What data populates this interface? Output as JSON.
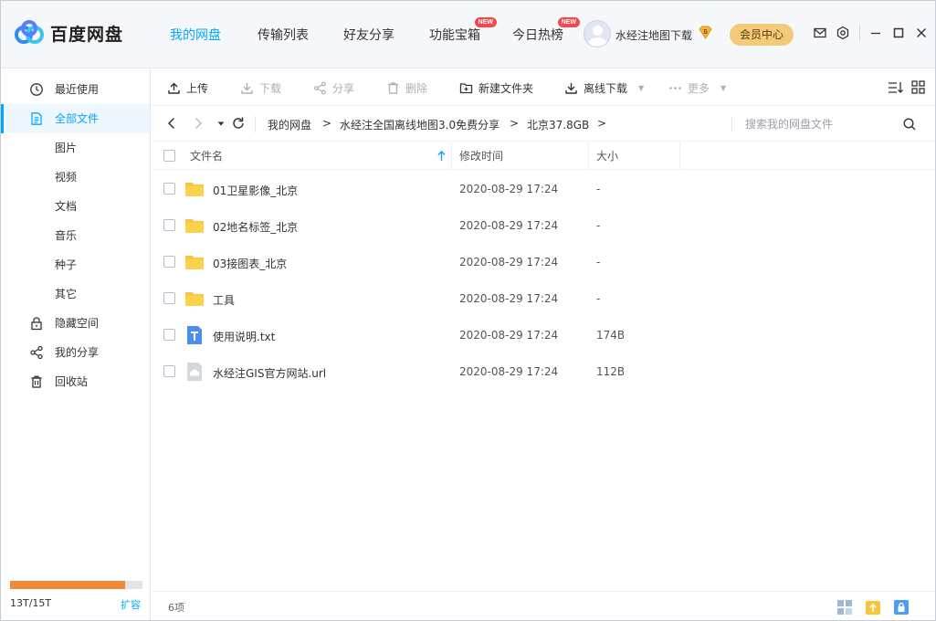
{
  "app": {
    "name": "百度网盘"
  },
  "nav": {
    "tabs": [
      {
        "label": "我的网盘",
        "active": true
      },
      {
        "label": "传输列表"
      },
      {
        "label": "好友分享"
      },
      {
        "label": "功能宝箱",
        "badge": "NEW"
      },
      {
        "label": "今日热榜",
        "badge": "NEW"
      }
    ],
    "username": "水经注地图下载",
    "member_label": "会员中心",
    "accent_color": "#06a7ff"
  },
  "sidebar": {
    "items": [
      {
        "label": "最近使用",
        "icon": "clock-icon"
      },
      {
        "label": "全部文件",
        "icon": "document-icon",
        "active": true
      },
      {
        "label": "图片"
      },
      {
        "label": "视频"
      },
      {
        "label": "文档"
      },
      {
        "label": "音乐"
      },
      {
        "label": "种子"
      },
      {
        "label": "其它"
      },
      {
        "label": "隐藏空间",
        "icon": "lock-icon"
      },
      {
        "label": "我的分享",
        "icon": "share-icon"
      },
      {
        "label": "回收站",
        "icon": "trash-icon"
      }
    ],
    "quota": {
      "text": "13T/15T",
      "used_fraction": 0.867,
      "expand_label": "扩容"
    }
  },
  "toolbar": {
    "upload": "上传",
    "download": "下载",
    "share": "分享",
    "delete": "删除",
    "new_folder": "新建文件夹",
    "offline_download": "离线下载",
    "more": "更多"
  },
  "pathbar": {
    "crumbs": [
      "我的网盘",
      "水经注全国离线地图3.0免费分享",
      "北京37.8GB"
    ],
    "separator": ">",
    "search_placeholder": "搜索我的网盘文件"
  },
  "table": {
    "headers": {
      "name": "文件名",
      "time": "修改时间",
      "size": "大小"
    },
    "rows": [
      {
        "name": "01卫星影像_北京",
        "time": "2020-08-29 17:24",
        "size": "-",
        "type": "folder"
      },
      {
        "name": "02地名标签_北京",
        "time": "2020-08-29 17:24",
        "size": "-",
        "type": "folder"
      },
      {
        "name": "03接图表_北京",
        "time": "2020-08-29 17:24",
        "size": "-",
        "type": "folder"
      },
      {
        "name": "工具",
        "time": "2020-08-29 17:24",
        "size": "-",
        "type": "folder"
      },
      {
        "name": "使用说明.txt",
        "time": "2020-08-29 17:24",
        "size": "174B",
        "type": "txt"
      },
      {
        "name": "水经注GIS官方网站.url",
        "time": "2020-08-29 17:24",
        "size": "112B",
        "type": "url"
      }
    ]
  },
  "footer": {
    "count": "6项"
  }
}
